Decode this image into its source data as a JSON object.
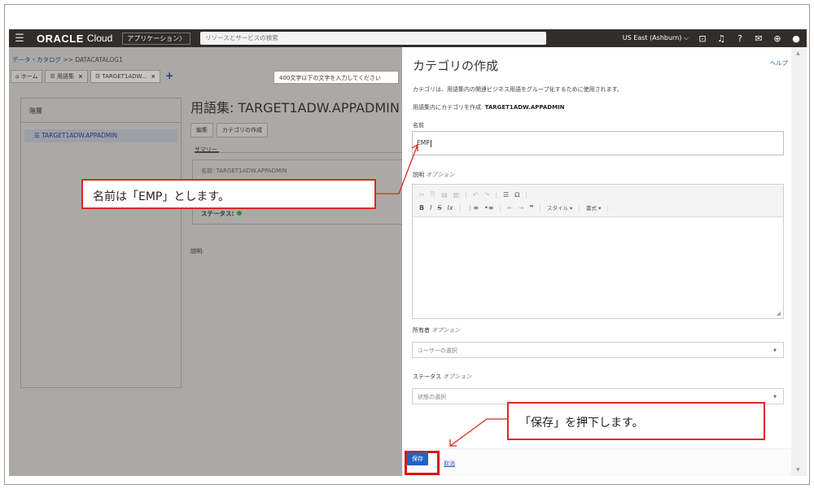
{
  "header": {
    "logo": "ORACLE",
    "logo_sub": "Cloud",
    "apps_label": "アプリケーション〉",
    "search_placeholder": "リソースとサービスの検索",
    "region": "US East (Ashburn) ⌵",
    "icons": [
      "cloud-shell-icon",
      "bell-icon",
      "help-icon",
      "chat-icon",
      "globe-icon",
      "profile-icon"
    ]
  },
  "breadcrumb": {
    "root": "データ・カタログ",
    "sep": " >> ",
    "current": "DATACATALOG1"
  },
  "tabs": [
    {
      "label": "ホーム"
    },
    {
      "label": "用語集"
    },
    {
      "label": "TARGET1ADW..."
    }
  ],
  "hierarchy": {
    "title": "階層",
    "item": "TARGET1ADW.APPADMIN"
  },
  "glossary": {
    "title": "用語集: TARGET1ADW.APPADMIN",
    "edit_btn": "編集",
    "create_category_btn": "カテゴリの作成",
    "summary_tab": "サマリー",
    "card_cut_text": "名前: TARGET1ADW.APPADMIN",
    "status_label": "ステータス:",
    "description_label": "説明:"
  },
  "tooltip": "400文字以下の文字を入力してください",
  "panel": {
    "title": "カテゴリの作成",
    "help": "ヘルプ",
    "description": "カテゴリは、用語集内の関連ビジネス用語をグループ化するために使用されます。",
    "context_prefix": "用語集内にカテゴリを作成:",
    "context_value": "TARGET1ADW.APPADMIN",
    "name_label": "名前",
    "name_value": "EMP",
    "desc_label": "説明",
    "optional": "オプション",
    "owner_label": "所有者",
    "owner_placeholder": "ユーザーの選択",
    "status_label": "ステータス",
    "status_placeholder": "状態の選択",
    "toolbar": {
      "style_dd": "スタイル",
      "format_dd": "書式"
    },
    "save": "保存",
    "cancel": "取消"
  },
  "callouts": {
    "name_note": "名前は「EMP」とします。",
    "save_note": "「保存」を押下します。"
  },
  "colors": {
    "topbar": "#312d2a",
    "overlay": "#aaa9a6",
    "primary_button": "#1f63c6",
    "highlight": "#d82a1f",
    "status_active": "#3a8a2d"
  }
}
